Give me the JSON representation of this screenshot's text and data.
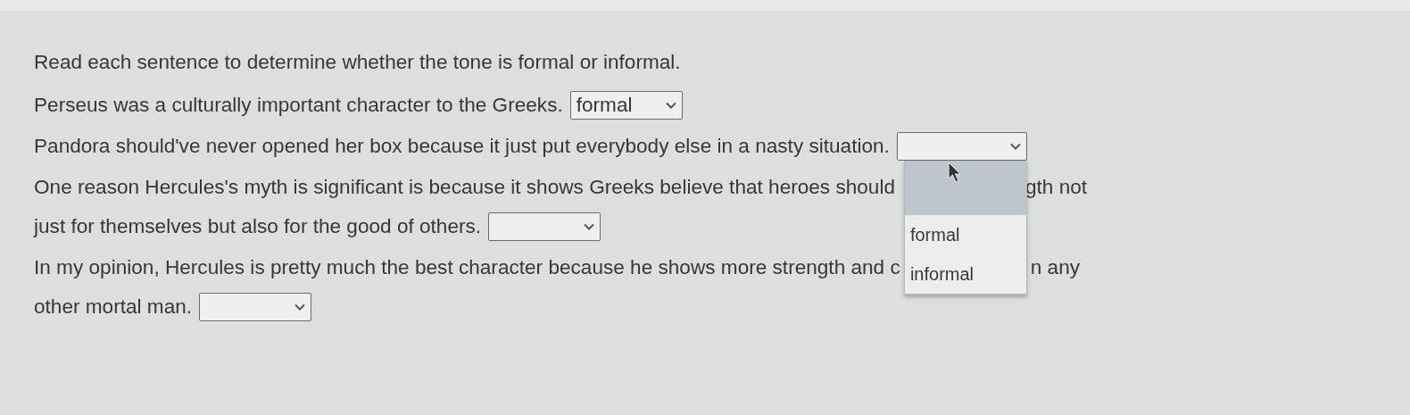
{
  "instruction": "Read each sentence to determine whether the tone is formal or informal.",
  "items": [
    {
      "lines": [
        [
          "Perseus was a culturally important character to the Greeks."
        ]
      ],
      "dropdown": {
        "value": "formal",
        "open": false
      }
    },
    {
      "lines": [
        [
          "Pandora should've never opened her box because it just put everybody else in a nasty situation."
        ]
      ],
      "dropdown": {
        "open": true,
        "blank_option_highlighted": true,
        "options": [
          "formal",
          "informal"
        ]
      }
    },
    {
      "lines": [
        [
          "One reason Hercules's myth is significant is because it shows Greeks believe that heroes should",
          "gth not"
        ],
        [
          "just for themselves but also for the good of others."
        ]
      ],
      "dropdown": {
        "open": false
      }
    },
    {
      "lines": [
        [
          "In my opinion, Hercules is pretty much the best character because he shows more strength and c",
          "n any"
        ],
        [
          "other mortal man."
        ]
      ],
      "dropdown": {
        "open": false
      }
    }
  ]
}
